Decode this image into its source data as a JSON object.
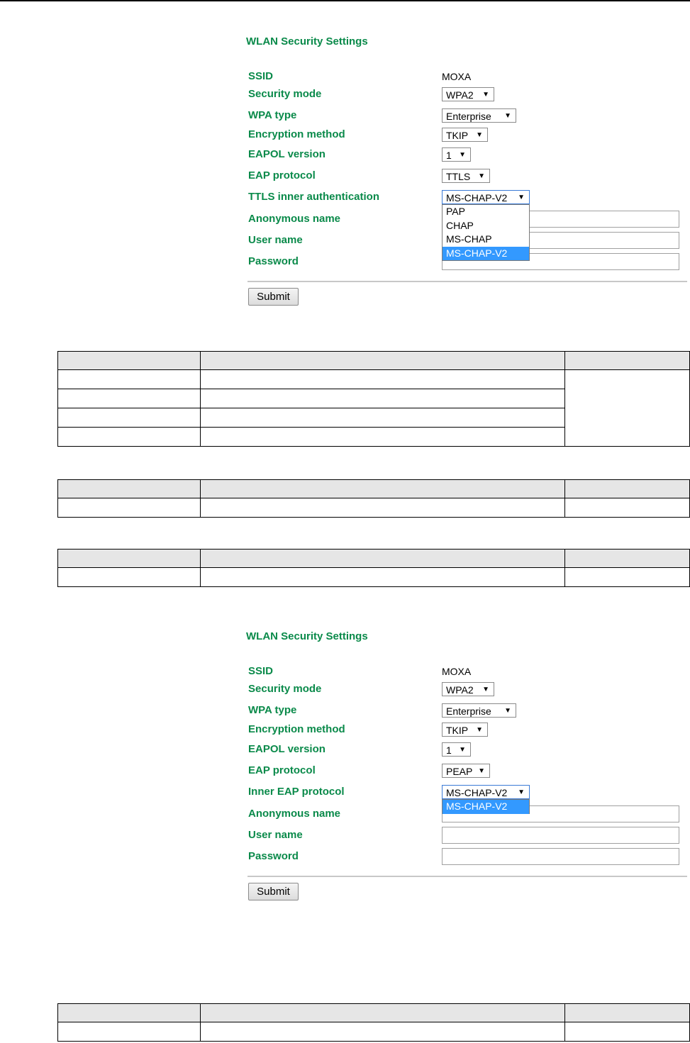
{
  "panel1": {
    "title": "WLAN Security Settings",
    "ssid_label": "SSID",
    "ssid_value": "MOXA",
    "security_mode_label": "Security mode",
    "security_mode_value": "WPA2",
    "wpa_type_label": "WPA type",
    "wpa_type_value": "Enterprise",
    "encryption_label": "Encryption method",
    "encryption_value": "TKIP",
    "eapol_label": "EAPOL version",
    "eapol_value": "1",
    "eap_protocol_label": "EAP protocol",
    "eap_protocol_value": "TTLS",
    "inner_label": "TTLS inner authentication",
    "inner_value": "MS-CHAP-V2",
    "inner_options": [
      "PAP",
      "CHAP",
      "MS-CHAP",
      "MS-CHAP-V2"
    ],
    "anonymous_label": "Anonymous name",
    "username_label": "User name",
    "password_label": "Password",
    "submit_label": "Submit"
  },
  "panel2": {
    "title": "WLAN Security Settings",
    "ssid_label": "SSID",
    "ssid_value": "MOXA",
    "security_mode_label": "Security mode",
    "security_mode_value": "WPA2",
    "wpa_type_label": "WPA type",
    "wpa_type_value": "Enterprise",
    "encryption_label": "Encryption method",
    "encryption_value": "TKIP",
    "eapol_label": "EAPOL version",
    "eapol_value": "1",
    "eap_protocol_label": "EAP protocol",
    "eap_protocol_value": "PEAP",
    "inner_label": "Inner EAP protocol",
    "inner_value": "MS-CHAP-V2",
    "inner_options": [
      "MS-CHAP-V2"
    ],
    "anonymous_label": "Anonymous name",
    "username_label": "User name",
    "password_label": "Password",
    "submit_label": "Submit"
  },
  "icons": {
    "dropdown_arrow": "▼"
  },
  "colors": {
    "label_green": "#0a8a4a",
    "option_highlight": "#3399ff",
    "table_header": "#e6e6e6"
  }
}
